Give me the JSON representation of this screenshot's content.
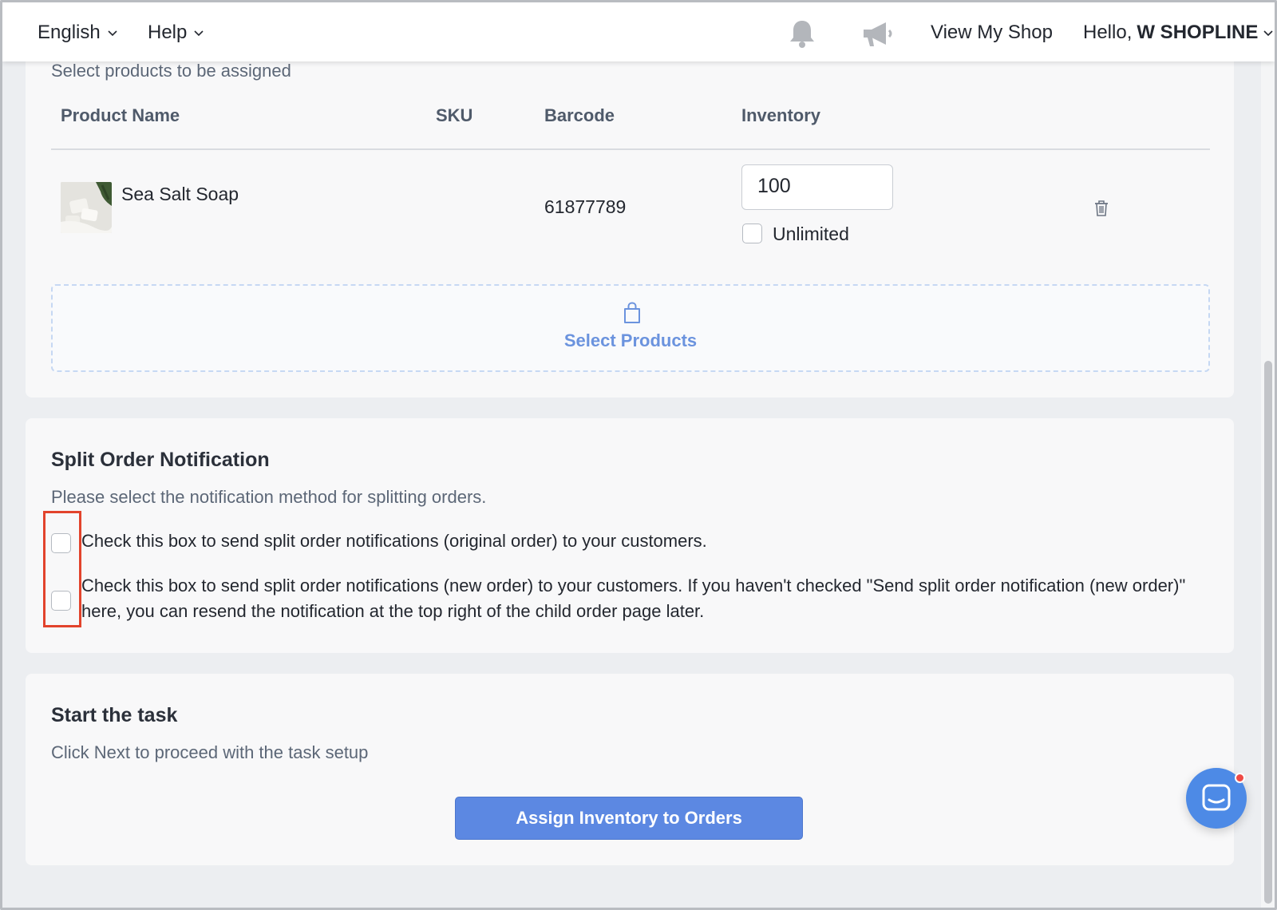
{
  "topbar": {
    "language": "English",
    "help": "Help",
    "view_shop": "View My Shop",
    "greeting": "Hello,",
    "shop_name": "W SHOPLINE"
  },
  "products_card": {
    "subtitle": "Select products to be assigned",
    "columns": [
      "Product Name",
      "SKU",
      "Barcode",
      "Inventory"
    ],
    "rows": [
      {
        "name": "Sea Salt Soap",
        "sku": "",
        "barcode": "61877789",
        "inventory": "100",
        "unlimited_label": "Unlimited"
      }
    ],
    "select_products": "Select Products"
  },
  "notification_card": {
    "title": "Split Order Notification",
    "subtitle": "Please select the notification method for splitting orders.",
    "options": [
      "Check this box to send split order notifications (original order) to your customers.",
      "Check this box to send split order notifications (new order) to your customers. If you haven't checked \"Send split order notification (new order)\" here, you can resend the notification at the top right of the child order page later."
    ]
  },
  "task_card": {
    "title": "Start the task",
    "subtitle": "Click Next to proceed with the task setup",
    "button": "Assign Inventory to Orders"
  },
  "colors": {
    "accent": "#5c88e2",
    "highlight": "#e2432c",
    "chat": "#4d8ae6"
  }
}
